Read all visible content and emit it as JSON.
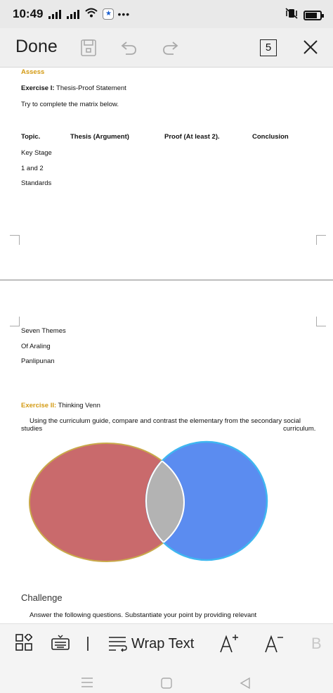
{
  "status": {
    "time": "10:49",
    "dots": "•••",
    "app_badge": "★"
  },
  "toolbar": {
    "done_label": "Done",
    "page_count": "5",
    "icons": [
      "save-icon",
      "undo-icon",
      "redo-icon",
      "close-icon"
    ]
  },
  "document": {
    "assess_heading": "Assess",
    "exercise1_label": "Exercise I:",
    "exercise1_title": " Thesis-Proof Statement",
    "instruction": "Try to complete the matrix below.",
    "matrix_headers": [
      "Topic.",
      "Thesis (Argument)",
      "Proof (At least 2).",
      "Conclusion"
    ],
    "topic_lines": [
      "Key Stage",
      "1 and 2",
      "Standards",
      "Seven Themes",
      "Of Araling",
      "Panlipunan"
    ],
    "exercise2_label": "Exercise II:",
    "exercise2_title": " Thinking Venn",
    "exercise2_instruction_line1": "Using the curriculum guide, compare and contrast the elementary from the secondary social",
    "exercise2_instruction_left": "studies",
    "exercise2_instruction_right": "curriculum.",
    "challenge_heading": "Challenge",
    "challenge_text": "Answer the following questions. Substantiate your point by providing relevant"
  },
  "venn": {
    "left_color": "#c96a6c",
    "right_color": "#5b8cf0",
    "overlap_color": "#b3b3b3"
  },
  "format_bar": {
    "wrap_text_label": "Wrap Text",
    "bold_label": "B"
  }
}
